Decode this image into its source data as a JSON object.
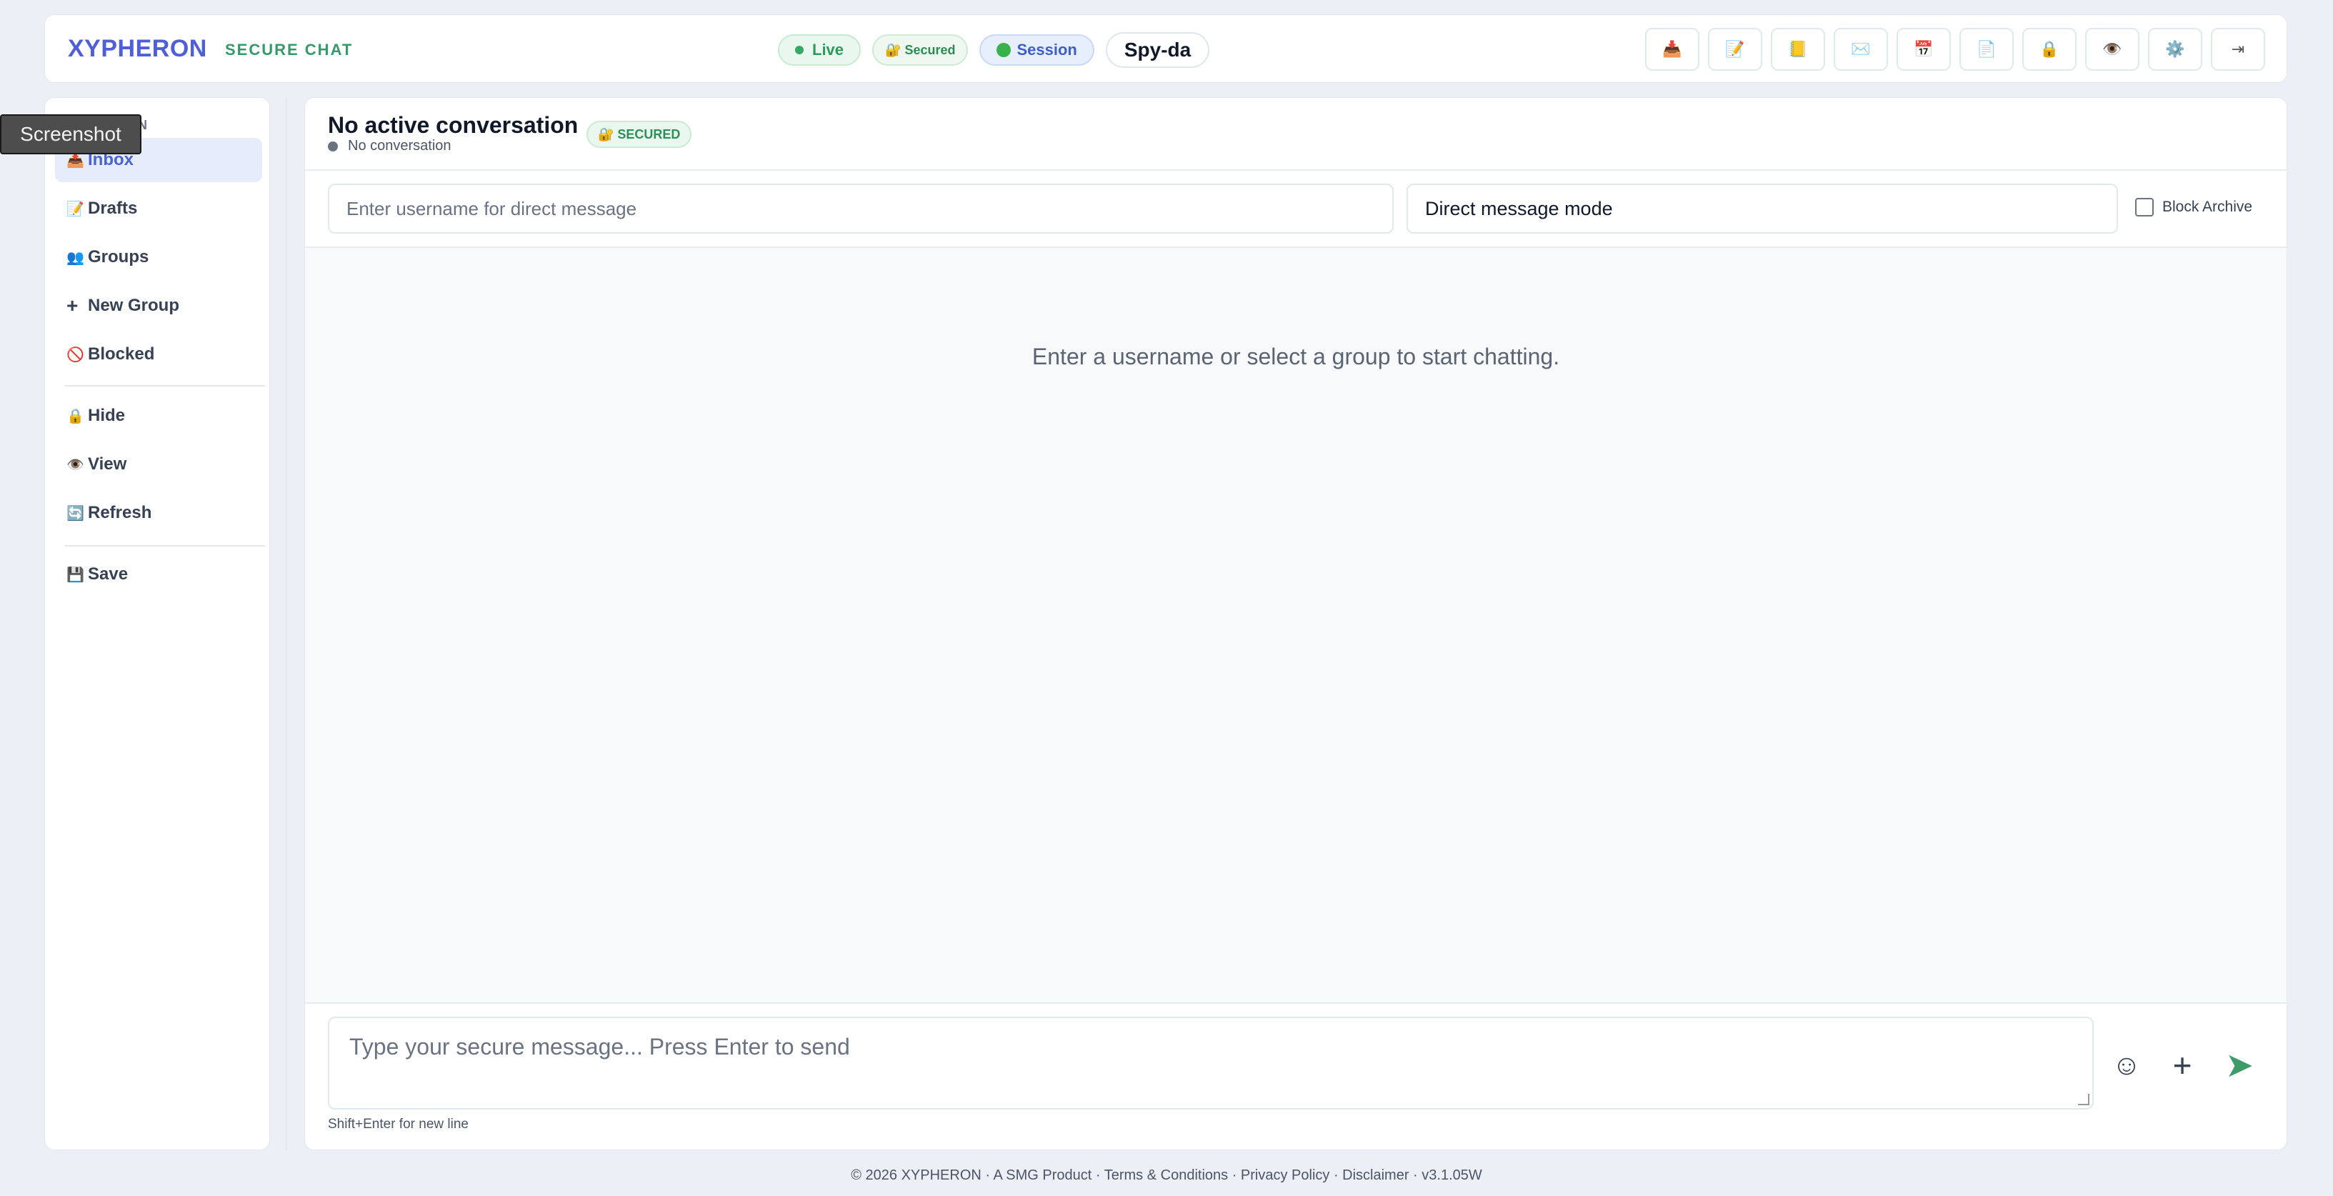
{
  "header": {
    "brand": "XYPHERON",
    "brand_sub": "SECURE CHAT",
    "status": {
      "live": "Live",
      "secured": "🔐 Secured",
      "session": "Session"
    },
    "username": "Spy-da",
    "tools": [
      {
        "icon": "📥",
        "name": "inbox-tool-icon"
      },
      {
        "icon": "📝",
        "name": "notes-tool-icon"
      },
      {
        "icon": "📒",
        "name": "notebook-tool-icon"
      },
      {
        "icon": "✉️",
        "name": "mail-tool-icon"
      },
      {
        "icon": "📅",
        "name": "calendar-tool-icon"
      },
      {
        "icon": "📄",
        "name": "document-tool-icon"
      },
      {
        "icon": "🔒",
        "name": "lock-tool-icon"
      },
      {
        "icon": "👁️",
        "name": "eye-tool-icon"
      },
      {
        "icon": "⚙️",
        "name": "settings-tool-icon"
      },
      {
        "icon": "⇥",
        "name": "logout-icon"
      }
    ]
  },
  "tooltip": "Screenshot",
  "sidebar": {
    "heading": "N",
    "items": [
      {
        "icon": "📥",
        "label": "Inbox"
      },
      {
        "icon": "📝",
        "label": "Drafts"
      },
      {
        "icon": "👥",
        "label": "Groups"
      },
      {
        "icon": "+",
        "label": "New Group"
      },
      {
        "icon": "🚫",
        "label": "Blocked"
      },
      {
        "icon": "🔒",
        "label": "Hide"
      },
      {
        "icon": "👁️",
        "label": "View"
      },
      {
        "icon": "🔄",
        "label": "Refresh"
      },
      {
        "icon": "💾",
        "label": "Save"
      }
    ]
  },
  "conversation": {
    "title": "No active conversation",
    "badge": "🔐 SECURED",
    "subtitle": "No conversation",
    "username_placeholder": "Enter username for direct message",
    "mode": "Direct message mode",
    "block_archive": "Block Archive",
    "empty_state": "Enter a username or select a group to start chatting.",
    "composer_placeholder": "Type your secure message... Press Enter to send",
    "hint": "Shift+Enter for new line",
    "emoji_icon": "☺",
    "attach_icon": "+",
    "send_icon": "➤"
  },
  "footer": "© 2026 XYPHERON · A SMG Product · Terms & Conditions · Privacy Policy · Disclaimer · v3.1.05W",
  "colors": {
    "accent": "#4f5fd8",
    "green": "#37996b",
    "send": "#3e9b67"
  }
}
